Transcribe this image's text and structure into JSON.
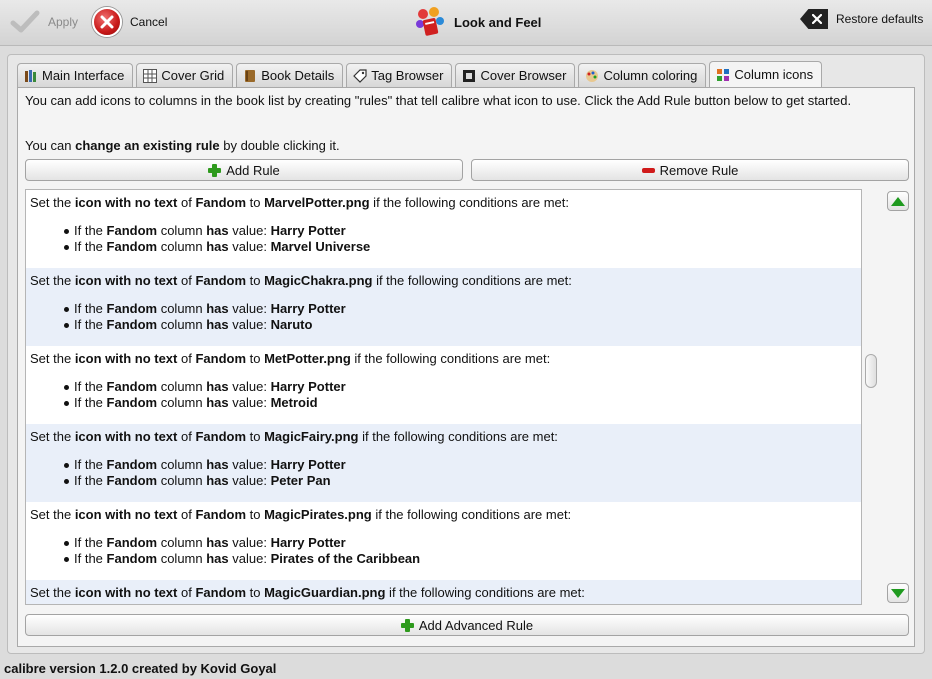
{
  "toolbar": {
    "apply_label": "Apply",
    "cancel_label": "Cancel",
    "title": "Look and Feel",
    "restore_label": "Restore defaults"
  },
  "tabs": [
    {
      "label": "Main Interface",
      "icon": "books-icon"
    },
    {
      "label": "Cover Grid",
      "icon": "grid-icon"
    },
    {
      "label": "Book Details",
      "icon": "book-icon"
    },
    {
      "label": "Tag Browser",
      "icon": "tag-icon"
    },
    {
      "label": "Cover Browser",
      "icon": "cover-icon"
    },
    {
      "label": "Column coloring",
      "icon": "palette-icon"
    },
    {
      "label": "Column icons",
      "icon": "icons-icon",
      "active": true
    }
  ],
  "info": {
    "line1": "You can add icons to columns in the book list by creating \"rules\" that tell calibre what icon to use. Click the Add Rule button below to get started.",
    "line2_pre": "You can ",
    "line2_bold": "change an existing rule",
    "line2_post": " by double clicking it."
  },
  "buttons": {
    "add_rule": "Add Rule",
    "remove_rule": "Remove Rule",
    "add_advanced_rule": "Add Advanced Rule"
  },
  "rule_text": {
    "set_the": "Set the ",
    "kind": "icon with no text",
    "of": " of ",
    "to": " to ",
    "tail": " if the following conditions are met:",
    "if_the": "If the ",
    "column": " column ",
    "has": "has",
    "value": " value: "
  },
  "rules": [
    {
      "column": "Fandom",
      "file": "MarvelPotter.png",
      "values": [
        "Harry Potter",
        "Marvel Universe"
      ]
    },
    {
      "column": "Fandom",
      "file": "MagicChakra.png",
      "values": [
        "Harry Potter",
        "Naruto"
      ]
    },
    {
      "column": "Fandom",
      "file": "MetPotter.png",
      "values": [
        "Harry Potter",
        "Metroid"
      ]
    },
    {
      "column": "Fandom",
      "file": "MagicFairy.png",
      "values": [
        "Harry Potter",
        "Peter Pan"
      ]
    },
    {
      "column": "Fandom",
      "file": "MagicPirates.png",
      "values": [
        "Harry Potter",
        "Pirates of the Caribbean"
      ]
    },
    {
      "column": "Fandom",
      "file": "MagicGuardian.png",
      "values": []
    }
  ],
  "status": "calibre version 1.2.0 created by Kovid Goyal"
}
